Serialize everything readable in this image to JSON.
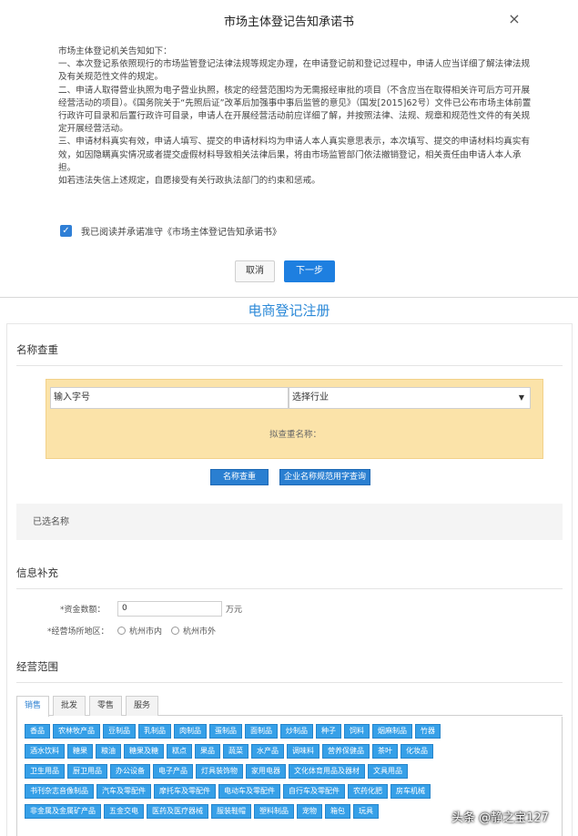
{
  "modal": {
    "title": "市场主体登记告知承诺书",
    "close_symbol": "×",
    "notice": [
      "市场主体登记机关告知如下：",
      "一、本次登记系依照现行的市场监管登记法律法规等规定办理，在申请登记前和登记过程中，申请人应当详细了解法律法规及有关规范性文件的规定。",
      "二、申请人取得营业执照为电子营业执照，核定的经营范围均为无需报经审批的项目（不含应当在取得相关许可后方可开展经营活动的项目）。《国务院关于“先照后证”改革后加强事中事后监管的意见》（国发[2015]62号）文件已公布市场主体前置行政许可目录和后置行政许可目录，申请人在开展经营活动前应详细了解，并按照法律、法规、规章和规范性文件的有关规定开展经营活动。",
      "三、申请材料真实有效，申请人填写、提交的申请材料均为申请人本人真实意思表示，本次填写、提交的申请材料均真实有效，如因隐瞒真实情况或者提交虚假材料导致相关法律后果，将由市场监管部门依法撤销登记，相关责任由申请人本人承担。",
      "如若违法失信上述规定，自愿接受有关行政执法部门的约束和惩戒。"
    ],
    "agree_text": "我已阅读并承诺准守《市场主体登记告知承诺书》",
    "agree_check": "✓",
    "cancel_label": "取消",
    "next_label": "下一步"
  },
  "registration": {
    "title": "电商登记注册",
    "name_section": {
      "title": "名称查重",
      "name_input_value": "输入字号",
      "industry_select_value": "选择行业",
      "pending_name_label": "拟查重名称：",
      "name_check_button": "名称查重",
      "norm_check_button": "企业名称规范用字查询",
      "selected_names_label": "已选名称"
    },
    "info_section": {
      "title": "信息补充",
      "capital_label": "*资金数额：",
      "capital_value": "0",
      "capital_unit": "万元",
      "area_label": "*经营场所地区：",
      "area_options": [
        "杭州市内",
        "杭州市外"
      ]
    },
    "scope_section": {
      "title": "经营范围",
      "tabs": [
        "销售",
        "批发",
        "零售",
        "服务"
      ],
      "active_tab": 0,
      "categories": [
        [
          "香品",
          "农林牧产品",
          "豆制品",
          "乳制品",
          "肉制品",
          "蛋制品",
          "面制品",
          "炒制品",
          "种子",
          "饲料",
          "烟麻制品",
          "竹器"
        ],
        [
          "酒水饮料",
          "糖果",
          "粮油",
          "糖果及糖",
          "糕点",
          "果品",
          "蔬菜",
          "水产品",
          "调味料",
          "营养保健品",
          "茶叶",
          "化妆品"
        ],
        [
          "卫生用品",
          "厨卫用品",
          "办公设备",
          "电子产品",
          "灯具装饰物",
          "家用电器",
          "文化体育用品及器材",
          "文具用品"
        ],
        [
          "书刊杂志音像制品",
          "汽车及零配件",
          "摩托车及零配件",
          "电动车及零配件",
          "自行车及零配件",
          "农药化肥",
          "房车机械"
        ],
        [
          "非金属及金属矿产品",
          "五金交电",
          "医药及医疗器械",
          "服装鞋帽",
          "塑料制品",
          "宠物",
          "箱包",
          "玩具"
        ]
      ]
    }
  },
  "watermark": "头条 @静之宝127"
}
